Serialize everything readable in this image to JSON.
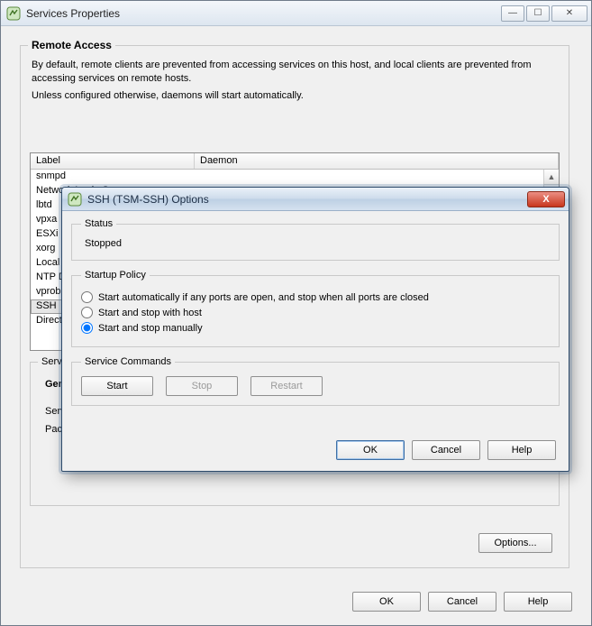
{
  "outer": {
    "title": "Services Properties",
    "win_min_tip": "Minimize",
    "win_max_tip": "Maximize",
    "win_close_tip": "Close"
  },
  "main": {
    "group_title": "Remote Access",
    "desc_line1": "By default, remote clients are prevented from accessing services on this host, and local clients are prevented from accessing services on remote hosts.",
    "desc_line2": "Unless configured otherwise, daemons will start automatically.",
    "table": {
      "col_label": "Label",
      "col_daemon": "Daemon",
      "rows": [
        {
          "label": "snmpd"
        },
        {
          "label": "Network Login Server"
        },
        {
          "label": "lbtd"
        },
        {
          "label": "vpxa"
        },
        {
          "label": "ESXi Shell"
        },
        {
          "label": "xorg"
        },
        {
          "label": "Local Security Authentication Server"
        },
        {
          "label": "NTP Daemon"
        },
        {
          "label": "vprobed"
        },
        {
          "label": "SSH",
          "selected": true
        },
        {
          "label": "Direct Console UI"
        }
      ]
    },
    "service_props": {
      "group_label": "Service Properties",
      "general_label": "General",
      "service_label": "Service:",
      "package_label": "Package Information:"
    },
    "options_btn": "Options...",
    "ok": "OK",
    "cancel": "Cancel",
    "help": "Help"
  },
  "modal": {
    "title": "SSH (TSM-SSH) Options",
    "close_tip": "Close",
    "status": {
      "legend": "Status",
      "value": "Stopped"
    },
    "startup": {
      "legend": "Startup Policy",
      "opt_auto": "Start automatically if any ports are open, and stop when all ports are closed",
      "opt_host": "Start and stop with host",
      "opt_manual": "Start and stop manually",
      "selected": "manual"
    },
    "commands": {
      "legend": "Service Commands",
      "start": "Start",
      "stop": "Stop",
      "restart": "Restart"
    },
    "ok": "OK",
    "cancel": "Cancel",
    "help": "Help"
  }
}
